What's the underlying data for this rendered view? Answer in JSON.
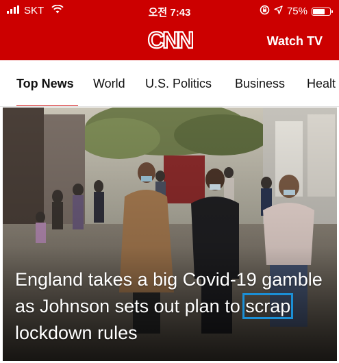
{
  "status_bar": {
    "carrier": "SKT",
    "time": "오전 7:43",
    "battery": "75%",
    "battery_level": 0.75
  },
  "header": {
    "logo": "CNN",
    "watch_tv": "Watch TV",
    "brand_color": "#cc0000"
  },
  "tabs": [
    {
      "label": "Top News",
      "active": true
    },
    {
      "label": "World",
      "active": false
    },
    {
      "label": "U.S. Politics",
      "active": false
    },
    {
      "label": "Business",
      "active": false
    },
    {
      "label": "Healt",
      "active": false
    }
  ],
  "hero": {
    "headline_before": "England takes a big Covid-19 gamble as Johnson sets out plan to",
    "headline_highlight": "scrap",
    "headline_after": "lockdown rules",
    "highlight_color": "#1b8fd6"
  },
  "icons": [
    "signal-bars-icon",
    "wifi-icon",
    "orientation-lock-icon",
    "location-arrow-icon",
    "battery-icon"
  ]
}
